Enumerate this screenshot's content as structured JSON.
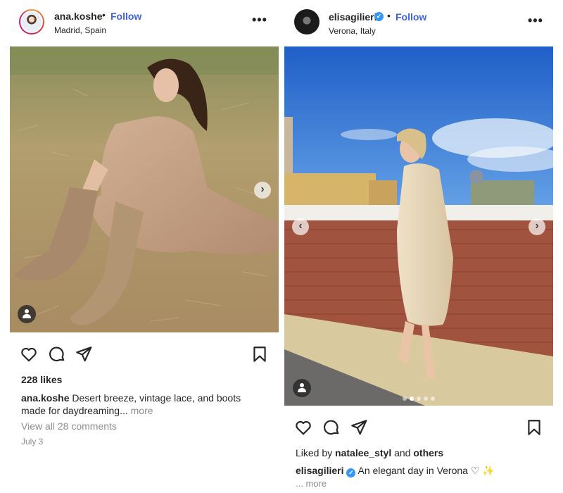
{
  "posts": [
    {
      "username": "ana.koshe",
      "separator": "•",
      "follow_label": "Follow",
      "location": "Madrid, Spain",
      "more_menu": "•••",
      "verified": false,
      "carousel_next": "›",
      "likes_text": "228 likes",
      "caption_user": "ana.koshe",
      "caption_text": "Desert breeze, vintage lace, and boots made for daydreaming...",
      "caption_more": "more",
      "view_comments": "View all 28 comments",
      "date": "July 3",
      "icons": [
        "heart-icon",
        "comment-icon",
        "share-icon",
        "bookmark-icon",
        "user-tag-icon"
      ]
    },
    {
      "username": "elisagilieri",
      "separator": "•",
      "follow_label": "Follow",
      "location": "Verona, Italy",
      "more_menu": "•••",
      "verified": true,
      "verified_mark": "✓",
      "carousel_prev": "‹",
      "carousel_next": "›",
      "carousel_dots": 5,
      "carousel_active": 2,
      "liked_by_prefix": "Liked by ",
      "liked_by_user": "natalee_styl",
      "liked_by_mid": " and ",
      "liked_by_others": "others",
      "caption_user": "elisagilieri",
      "caption_text": "An elegant day in Verona ♡ ✨",
      "caption_more": "... more",
      "icons": [
        "heart-icon",
        "comment-icon",
        "share-icon",
        "bookmark-icon",
        "user-tag-icon"
      ]
    }
  ],
  "colors": {
    "follow": "#3f63d6",
    "verified": "#3897f0",
    "text": "#262626",
    "muted": "#8e8e8e"
  }
}
